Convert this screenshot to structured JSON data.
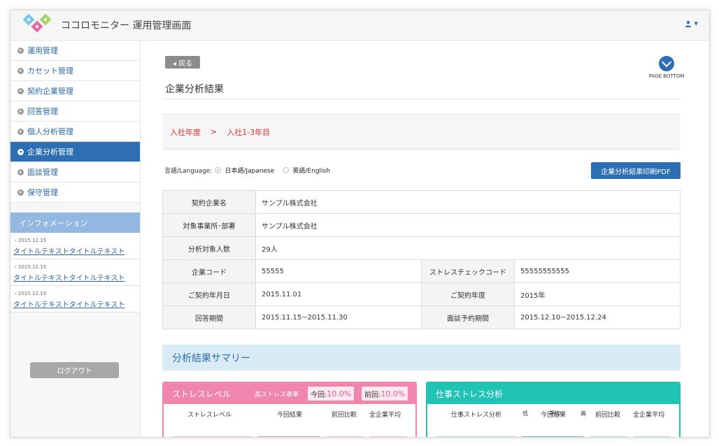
{
  "header": {
    "app_title": "ココロモニター 運用管理画面",
    "user_icon": "user-icon",
    "caret": "▾"
  },
  "sidebar": {
    "items": [
      {
        "label": "運用管理",
        "active": false
      },
      {
        "label": "カセット管理",
        "active": false
      },
      {
        "label": "契約企業管理",
        "active": false
      },
      {
        "label": "回答管理",
        "active": false
      },
      {
        "label": "個人分析管理",
        "active": false
      },
      {
        "label": "企業分析管理",
        "active": true
      },
      {
        "label": "面談管理",
        "active": false
      },
      {
        "label": "保守管理",
        "active": false
      }
    ],
    "info_title": "インフォメーション",
    "info_items": [
      {
        "date": "・2015.12.15",
        "title": "タイトルテキストタイトルテキスト"
      },
      {
        "date": "・2015.12.15",
        "title": "タイトルテキストタイトルテキスト"
      },
      {
        "date": "・2015.12.15",
        "title": "タイトルテキストタイトルテキスト"
      }
    ],
    "logout_label": "ログアウト"
  },
  "main": {
    "back_label": "◂ 戻る",
    "page_bottom_label": "PAGE BOTTOM",
    "title": "企業分析結果",
    "crumb": {
      "first": "入社年度",
      "sep": ">",
      "second": "入社1-3年目"
    },
    "language": {
      "label": "言語/Language:",
      "japanese": "日本語/Japanese",
      "english": "英語/English"
    },
    "pdf_button": "企業分析結果印刷PDF",
    "table": {
      "company_name_label": "契約企業名",
      "company_name": "サンプル株式会社",
      "office_label": "対象事業所･部署",
      "office": "サンプル株式会社",
      "count_label": "分析対象人数",
      "count": "29人",
      "code_label": "企業コード",
      "code": "55555",
      "stress_code_label": "ストレスチェックコード",
      "stress_code": "55555555555",
      "contract_date_label": "ご契約年月日",
      "contract_date": "2015.11.01",
      "contract_year_label": "ご契約年度",
      "contract_year": "2015年",
      "answer_period_label": "回答期間",
      "answer_period": "2015.11.15~2015.11.30",
      "interview_period_label": "面談予約期間",
      "interview_period": "2015.12.10~2015.12.24"
    },
    "summary_title": "分析結果サマリー",
    "stress_card": {
      "title": "ストレスレベル",
      "high_stress_label": "高ストレス者率",
      "current_label": "今回:",
      "current_value": "10.0%",
      "previous_label": "前回:",
      "previous_value": "10.0%",
      "cols": [
        "ストレスレベル",
        "今回結果",
        "前回比較",
        "全企業平均"
      ]
    },
    "work_card": {
      "title": "仕事ストレス分析",
      "cols": [
        "仕事ストレス分析",
        "今回結果",
        "前回比較",
        "全企業平均"
      ],
      "scale": [
        "低",
        "平均",
        "高"
      ]
    }
  }
}
